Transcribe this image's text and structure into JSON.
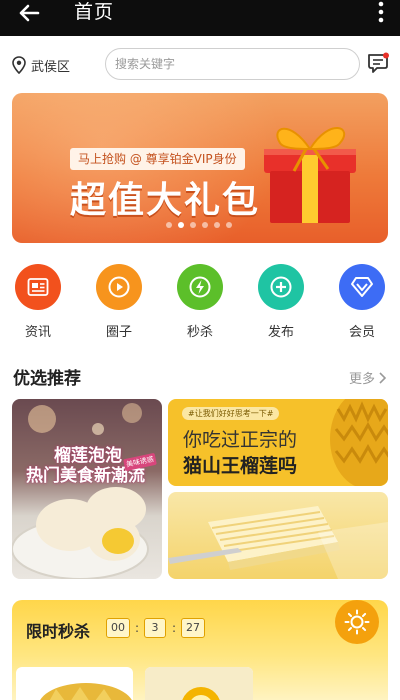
{
  "topbar": {
    "title": "首页",
    "back_icon": "arrow-left-icon",
    "more_icon": "more-vertical-icon"
  },
  "header": {
    "location": "武侯区",
    "search_placeholder": "搜索关键字",
    "message_icon": "message-icon"
  },
  "banner": {
    "subtitle": "马上抢购 @ 尊享铂金VIP身份",
    "headline": "超值大礼包",
    "slide_count": 6,
    "active_slide": 2
  },
  "menu": [
    {
      "label": "资讯",
      "icon": "news-icon",
      "color": "#f2511d"
    },
    {
      "label": "圈子",
      "icon": "circle-icon",
      "color": "#f7941d"
    },
    {
      "label": "秒杀",
      "icon": "flash-icon",
      "color": "#5cbf2a"
    },
    {
      "label": "发布",
      "icon": "plus-icon",
      "color": "#1fc4a3"
    },
    {
      "label": "会员",
      "icon": "diamond-icon",
      "color": "#3d6cf5"
    }
  ],
  "recommend": {
    "title": "优选推荐",
    "more": "更多",
    "left_card": {
      "line1": "榴莲泡泡",
      "line2": "热门美食新潮流",
      "tag": "美味诱惑"
    },
    "right_top_card": {
      "pill": "#让我们好好思考一下#",
      "line1": "你吃过正宗的",
      "line2": "猫山王榴莲吗"
    }
  },
  "flash_sale": {
    "title": "限时秒杀",
    "hours": "00",
    "minutes": "3",
    "seconds": "27",
    "separator": ":"
  },
  "colors": {
    "banner": "#ee7a3a",
    "accent_yellow": "#f6c12a",
    "topbar": "#0d0d0d"
  }
}
